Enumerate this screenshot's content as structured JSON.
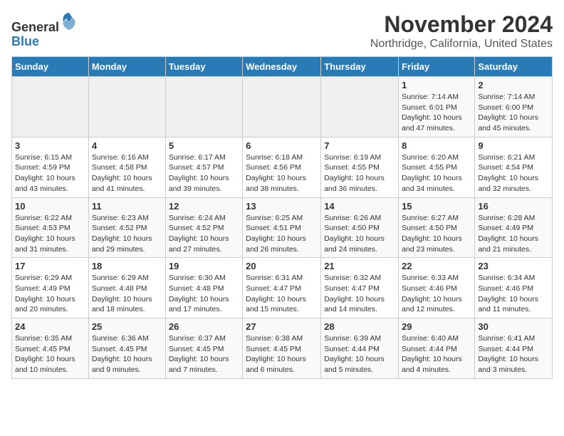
{
  "logo": {
    "general": "General",
    "blue": "Blue"
  },
  "title": "November 2024",
  "subtitle": "Northridge, California, United States",
  "weekdays": [
    "Sunday",
    "Monday",
    "Tuesday",
    "Wednesday",
    "Thursday",
    "Friday",
    "Saturday"
  ],
  "weeks": [
    [
      {
        "day": "",
        "info": ""
      },
      {
        "day": "",
        "info": ""
      },
      {
        "day": "",
        "info": ""
      },
      {
        "day": "",
        "info": ""
      },
      {
        "day": "",
        "info": ""
      },
      {
        "day": "1",
        "info": "Sunrise: 7:14 AM\nSunset: 6:01 PM\nDaylight: 10 hours and 47 minutes."
      },
      {
        "day": "2",
        "info": "Sunrise: 7:14 AM\nSunset: 6:00 PM\nDaylight: 10 hours and 45 minutes."
      }
    ],
    [
      {
        "day": "3",
        "info": "Sunrise: 6:15 AM\nSunset: 4:59 PM\nDaylight: 10 hours and 43 minutes."
      },
      {
        "day": "4",
        "info": "Sunrise: 6:16 AM\nSunset: 4:58 PM\nDaylight: 10 hours and 41 minutes."
      },
      {
        "day": "5",
        "info": "Sunrise: 6:17 AM\nSunset: 4:57 PM\nDaylight: 10 hours and 39 minutes."
      },
      {
        "day": "6",
        "info": "Sunrise: 6:18 AM\nSunset: 4:56 PM\nDaylight: 10 hours and 38 minutes."
      },
      {
        "day": "7",
        "info": "Sunrise: 6:19 AM\nSunset: 4:55 PM\nDaylight: 10 hours and 36 minutes."
      },
      {
        "day": "8",
        "info": "Sunrise: 6:20 AM\nSunset: 4:55 PM\nDaylight: 10 hours and 34 minutes."
      },
      {
        "day": "9",
        "info": "Sunrise: 6:21 AM\nSunset: 4:54 PM\nDaylight: 10 hours and 32 minutes."
      }
    ],
    [
      {
        "day": "10",
        "info": "Sunrise: 6:22 AM\nSunset: 4:53 PM\nDaylight: 10 hours and 31 minutes."
      },
      {
        "day": "11",
        "info": "Sunrise: 6:23 AM\nSunset: 4:52 PM\nDaylight: 10 hours and 29 minutes."
      },
      {
        "day": "12",
        "info": "Sunrise: 6:24 AM\nSunset: 4:52 PM\nDaylight: 10 hours and 27 minutes."
      },
      {
        "day": "13",
        "info": "Sunrise: 6:25 AM\nSunset: 4:51 PM\nDaylight: 10 hours and 26 minutes."
      },
      {
        "day": "14",
        "info": "Sunrise: 6:26 AM\nSunset: 4:50 PM\nDaylight: 10 hours and 24 minutes."
      },
      {
        "day": "15",
        "info": "Sunrise: 6:27 AM\nSunset: 4:50 PM\nDaylight: 10 hours and 23 minutes."
      },
      {
        "day": "16",
        "info": "Sunrise: 6:28 AM\nSunset: 4:49 PM\nDaylight: 10 hours and 21 minutes."
      }
    ],
    [
      {
        "day": "17",
        "info": "Sunrise: 6:29 AM\nSunset: 4:49 PM\nDaylight: 10 hours and 20 minutes."
      },
      {
        "day": "18",
        "info": "Sunrise: 6:29 AM\nSunset: 4:48 PM\nDaylight: 10 hours and 18 minutes."
      },
      {
        "day": "19",
        "info": "Sunrise: 6:30 AM\nSunset: 4:48 PM\nDaylight: 10 hours and 17 minutes."
      },
      {
        "day": "20",
        "info": "Sunrise: 6:31 AM\nSunset: 4:47 PM\nDaylight: 10 hours and 15 minutes."
      },
      {
        "day": "21",
        "info": "Sunrise: 6:32 AM\nSunset: 4:47 PM\nDaylight: 10 hours and 14 minutes."
      },
      {
        "day": "22",
        "info": "Sunrise: 6:33 AM\nSunset: 4:46 PM\nDaylight: 10 hours and 12 minutes."
      },
      {
        "day": "23",
        "info": "Sunrise: 6:34 AM\nSunset: 4:46 PM\nDaylight: 10 hours and 11 minutes."
      }
    ],
    [
      {
        "day": "24",
        "info": "Sunrise: 6:35 AM\nSunset: 4:45 PM\nDaylight: 10 hours and 10 minutes."
      },
      {
        "day": "25",
        "info": "Sunrise: 6:36 AM\nSunset: 4:45 PM\nDaylight: 10 hours and 9 minutes."
      },
      {
        "day": "26",
        "info": "Sunrise: 6:37 AM\nSunset: 4:45 PM\nDaylight: 10 hours and 7 minutes."
      },
      {
        "day": "27",
        "info": "Sunrise: 6:38 AM\nSunset: 4:45 PM\nDaylight: 10 hours and 6 minutes."
      },
      {
        "day": "28",
        "info": "Sunrise: 6:39 AM\nSunset: 4:44 PM\nDaylight: 10 hours and 5 minutes."
      },
      {
        "day": "29",
        "info": "Sunrise: 6:40 AM\nSunset: 4:44 PM\nDaylight: 10 hours and 4 minutes."
      },
      {
        "day": "30",
        "info": "Sunrise: 6:41 AM\nSunset: 4:44 PM\nDaylight: 10 hours and 3 minutes."
      }
    ]
  ]
}
